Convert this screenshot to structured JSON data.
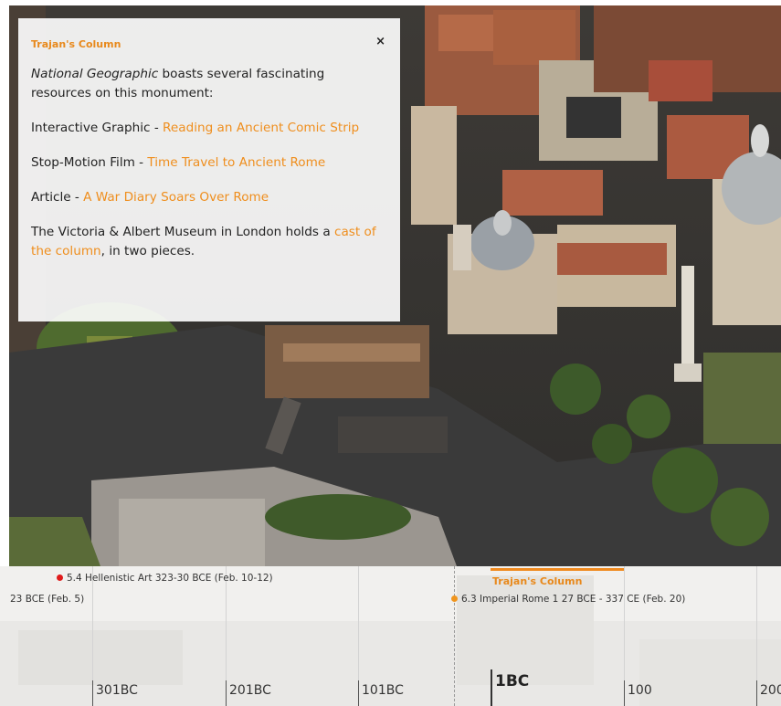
{
  "popup": {
    "title": "Trajan's Column",
    "close_symbol": "×",
    "intro_em": "National Geographic",
    "intro_rest": " boasts several fascinating resources on this monument:",
    "items": [
      {
        "prefix": "Interactive Graphic - ",
        "link": "Reading an Ancient Comic Strip"
      },
      {
        "prefix": "Stop-Motion Film - ",
        "link": "Time Travel to Ancient Rome"
      },
      {
        "prefix": "Article - ",
        "link": "A War Diary Soars Over Rome"
      }
    ],
    "va_prefix": "The Victoria & Albert Museum in London holds a ",
    "va_link": "cast of the column",
    "va_suffix": ", in two pieces."
  },
  "timeline": {
    "events": [
      {
        "label": "5.4 Hellenistic Art 323-30 BCE (Feb. 10-12)",
        "color": "#e01b1b"
      },
      {
        "label": "23 BCE (Feb. 5)",
        "color": ""
      },
      {
        "label": "6.3 Imperial Rome 1 27 BCE - 337 CE (Feb. 20)",
        "color": "#f0951e"
      }
    ],
    "selected_title": "Trajan's Column",
    "ticks": [
      {
        "label": "301BC",
        "major": false
      },
      {
        "label": "201BC",
        "major": false
      },
      {
        "label": "101BC",
        "major": false
      },
      {
        "label": "1BC",
        "major": true
      },
      {
        "label": "100",
        "major": false
      },
      {
        "label": "200",
        "major": false
      }
    ]
  },
  "colors": {
    "accent": "#ef8e1d",
    "marker_red": "#e01b1b"
  },
  "icons": {
    "close": "close-icon"
  }
}
